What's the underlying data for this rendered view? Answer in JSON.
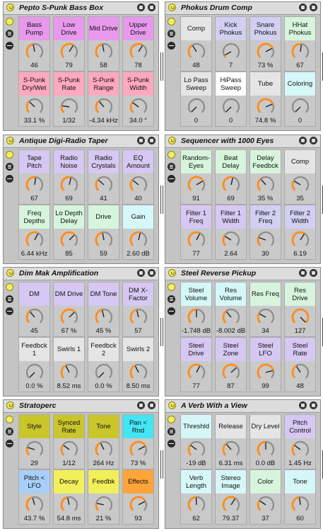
{
  "colors": {
    "violet": "#d6c8f2",
    "pink": "#ffa8c2",
    "magenta": "#e899ee",
    "gray": "#e5e5e5",
    "white": "#ffffff",
    "cyan": "#d6f7f7",
    "mint": "#d6f5dc",
    "lavender": "#d2cff2",
    "yellow": "#f1f05a",
    "olive": "#c9c62c",
    "aqua": "#43e6f2",
    "sky": "#a8cff7",
    "orange": "#ffa43a",
    "arc": "#ff8c1a"
  },
  "racks": [
    {
      "title": "Pepto S-Punk Bass Box",
      "macros": [
        {
          "label": "Bass Pump",
          "value": "46",
          "color": "magenta",
          "fill": 0.46
        },
        {
          "label": "Low Drive",
          "value": "79",
          "color": "magenta",
          "fill": 0.62
        },
        {
          "label": "Mid Drive",
          "value": "58",
          "color": "magenta",
          "fill": 0.46
        },
        {
          "label": "Upper Drive",
          "value": "78",
          "color": "magenta",
          "fill": 0.62
        },
        {
          "label": "S-Punk Dry/Wet",
          "value": "33.1 %",
          "color": "pink",
          "fill": 0.33
        },
        {
          "label": "S-Punk Rate",
          "value": "1/32",
          "color": "pink",
          "fill": 0.2
        },
        {
          "label": "S-Punk Range",
          "value": "-4.34 kHz",
          "color": "pink",
          "fill": 0.35
        },
        {
          "label": "S-Punk Width",
          "value": "34.0 °",
          "color": "pink",
          "fill": 0.3
        }
      ]
    },
    {
      "title": "Phokus Drum Comp",
      "macros": [
        {
          "label": "Comp",
          "value": "48",
          "color": "gray",
          "fill": 0.38
        },
        {
          "label": "Kick Phokus",
          "value": "7",
          "color": "lavender",
          "fill": 0.06
        },
        {
          "label": "Snare Phokus",
          "value": "73 %",
          "color": "lavender",
          "fill": 0.73
        },
        {
          "label": "HHat Phokus",
          "value": "67",
          "color": "mint",
          "fill": 0.53
        },
        {
          "label": "Lo Pass Sweep",
          "value": "0",
          "color": "gray",
          "fill": 0
        },
        {
          "label": "HiPass Sweep",
          "value": "0",
          "color": "white",
          "fill": 0
        },
        {
          "label": "Tube",
          "value": "74.8 %",
          "color": "gray",
          "fill": 0.75
        },
        {
          "label": "Coloring",
          "value": "0",
          "color": "cyan",
          "fill": 0
        }
      ]
    },
    {
      "title": "Antique Digi-Radio Taper",
      "macros": [
        {
          "label": "Tape Pitch",
          "value": "67",
          "color": "violet",
          "fill": 0.53
        },
        {
          "label": "Radio Noise",
          "value": "69",
          "color": "violet",
          "fill": 0.55
        },
        {
          "label": "Radio Crystals",
          "value": "41",
          "color": "violet",
          "fill": 0.32
        },
        {
          "label": "EQ Amount",
          "value": "40",
          "color": "violet",
          "fill": 0.31
        },
        {
          "label": "Freq Depths",
          "value": "6.44 kHz",
          "color": "mint",
          "fill": 0.6
        },
        {
          "label": "Lo Depth Delay",
          "value": "85",
          "color": "mint",
          "fill": 0.67
        },
        {
          "label": "Drive",
          "value": "59",
          "color": "mint",
          "fill": 0.46
        },
        {
          "label": "Gain",
          "value": "2.60 dB",
          "color": "cyan",
          "fill": 0.55
        }
      ]
    },
    {
      "title": "Sequencer with 1000 Eyes",
      "macros": [
        {
          "label": "Random-Eyes",
          "value": "91",
          "color": "mint",
          "fill": 0.72
        },
        {
          "label": "Beat Delay",
          "value": "69",
          "color": "mint",
          "fill": 0.55
        },
        {
          "label": "Delay Feedbck",
          "value": "35 %",
          "color": "mint",
          "fill": 0.35
        },
        {
          "label": "Comp",
          "value": "35",
          "color": "gray",
          "fill": 0.28
        },
        {
          "label": "Filter 1 Freq",
          "value": "77",
          "color": "violet",
          "fill": 0.6
        },
        {
          "label": "Filter 1 Width",
          "value": "2.64",
          "color": "violet",
          "fill": 0.28
        },
        {
          "label": "Filter 2 Freq",
          "value": "30",
          "color": "lavender",
          "fill": 0.24
        },
        {
          "label": "Filter 2 Width",
          "value": "6.19",
          "color": "lavender",
          "fill": 0.62
        }
      ]
    },
    {
      "title": "Dim Mak Amplification",
      "macros": [
        {
          "label": "DM",
          "value": "45",
          "color": "violet",
          "fill": 0.35
        },
        {
          "label": "DM Drive",
          "value": "67 %",
          "color": "violet",
          "fill": 0.67
        },
        {
          "label": "DM Tone",
          "value": "45 %",
          "color": "violet",
          "fill": 0.45
        },
        {
          "label": "DM X-Factor",
          "value": "57",
          "color": "violet",
          "fill": 0.45
        },
        {
          "label": "Feedbck 1",
          "value": "0.0 %",
          "color": "gray",
          "fill": 0
        },
        {
          "label": "Swirls 1",
          "value": "8.52 ms",
          "color": "gray",
          "fill": 0.4
        },
        {
          "label": "Feedbck 2",
          "value": "0.0 %",
          "color": "gray",
          "fill": 0
        },
        {
          "label": "Swirls 2",
          "value": "8.50 ms",
          "color": "gray",
          "fill": 0.4
        }
      ]
    },
    {
      "title": "Steel Reverse Pickup",
      "macros": [
        {
          "label": "Steel Volume",
          "value": "-1.748 dB",
          "color": "cyan",
          "fill": 0.5
        },
        {
          "label": "Res Volume",
          "value": "-8.002 dB",
          "color": "cyan",
          "fill": 0.35
        },
        {
          "label": "Res Freq",
          "value": "34",
          "color": "mint",
          "fill": 0.27
        },
        {
          "label": "Res Drive",
          "value": "127",
          "color": "mint",
          "fill": 1
        },
        {
          "label": "Steel Drive",
          "value": "77",
          "color": "violet",
          "fill": 0.6
        },
        {
          "label": "Steel Zone",
          "value": "87",
          "color": "violet",
          "fill": 0.68
        },
        {
          "label": "Steel LFO",
          "value": "99",
          "color": "violet",
          "fill": 0.78
        },
        {
          "label": "Steel Rate",
          "value": "48",
          "color": "violet",
          "fill": 0.38
        }
      ]
    },
    {
      "title": "Stratoperc",
      "macros": [
        {
          "label": "Style",
          "value": "29",
          "color": "olive",
          "fill": 0.23
        },
        {
          "label": "Synced Rate",
          "value": "1/12",
          "color": "olive",
          "fill": 0.3
        },
        {
          "label": "Tone",
          "value": "264 Hz",
          "color": "olive",
          "fill": 0.4
        },
        {
          "label": "Pan < Rnd",
          "value": "73 %",
          "color": "aqua",
          "fill": 0.73
        },
        {
          "label": "Pitch < LFO",
          "value": "43.7 %",
          "color": "sky",
          "fill": 0.44
        },
        {
          "label": "Decay",
          "value": "54.8 ms",
          "color": "yellow",
          "fill": 0.45
        },
        {
          "label": "Feedbk",
          "value": "21 %",
          "color": "yellow",
          "fill": 0.21
        },
        {
          "label": "Effects",
          "value": "93",
          "color": "orange",
          "fill": 0.73
        }
      ]
    },
    {
      "title": "A Verb With a View",
      "macros": [
        {
          "label": "Threshld",
          "value": "-19 dB",
          "color": "cyan",
          "fill": 0.3
        },
        {
          "label": "Release",
          "value": "6.31 ms",
          "color": "gray",
          "fill": 0.35
        },
        {
          "label": "Dry Level",
          "value": "0.0 dB",
          "color": "gray",
          "fill": 0.5
        },
        {
          "label": "Pitch Control",
          "value": "1.45 Hz",
          "color": "violet",
          "fill": 0.3
        },
        {
          "label": "Verb Length",
          "value": "62",
          "color": "cyan",
          "fill": 0.49
        },
        {
          "label": "Stereo Image",
          "value": "79.37",
          "color": "cyan",
          "fill": 0.62
        },
        {
          "label": "Color",
          "value": "37",
          "color": "mint",
          "fill": 0.29
        },
        {
          "label": "Tone",
          "value": "60",
          "color": "cyan",
          "fill": 0.47
        }
      ]
    }
  ]
}
